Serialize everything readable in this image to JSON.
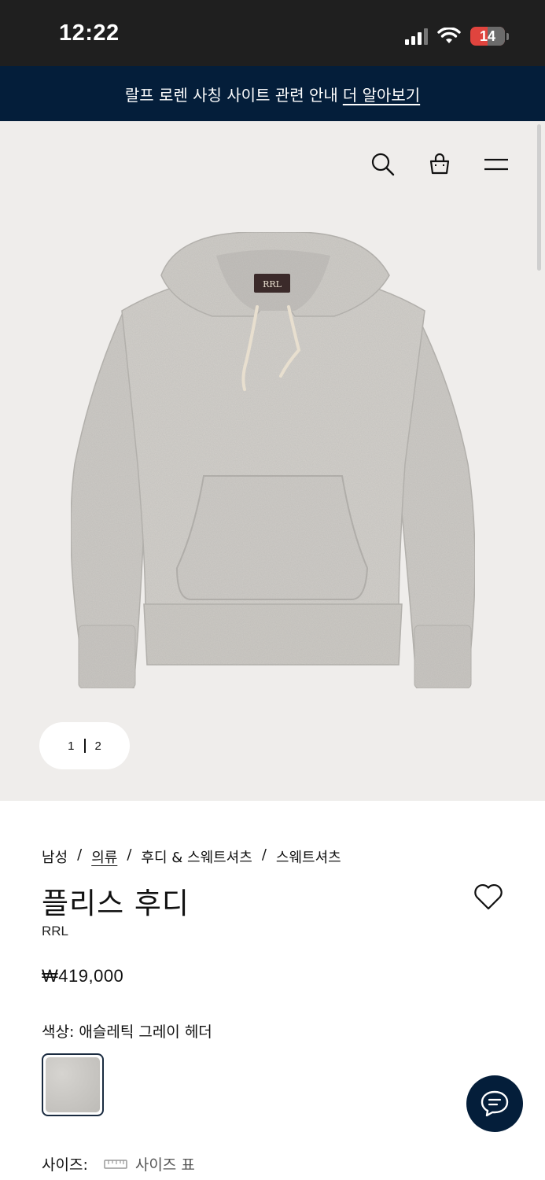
{
  "status_bar": {
    "time": "12:22",
    "battery": "14"
  },
  "announcement": {
    "text": "랄프 로렌 사칭 사이트 관련 안내",
    "link": "더 알아보기"
  },
  "header": {
    "icons": [
      "search-icon",
      "shopping-bag-icon",
      "menu-icon"
    ]
  },
  "gallery": {
    "current": "1",
    "total": "2"
  },
  "breadcrumb": {
    "items": [
      "남성",
      "의류",
      "후디 & 스웨트셔츠",
      "스웨트셔츠"
    ],
    "separator": "/"
  },
  "product": {
    "title": "플리스 후디",
    "brand": "RRL",
    "price": "₩419,000",
    "color_label": "색상:",
    "color_value": "애슬레틱 그레이 헤더",
    "size_label": "사이즈:",
    "size_chart": "사이즈 표"
  },
  "colors": {
    "accent": "#041e3a",
    "hero_bg": "#efedeb",
    "hoodie": "#cfccc7"
  }
}
